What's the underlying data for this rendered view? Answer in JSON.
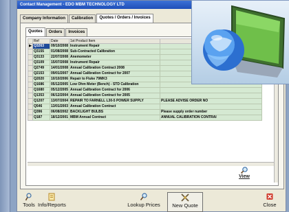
{
  "window": {
    "title": "Contact Management - EDO MBM TECHNOLOGY LTD"
  },
  "outer_tabs": [
    {
      "label": "Company Information"
    },
    {
      "label": "Calibration"
    },
    {
      "label": "Quotes / Orders / Invoices"
    }
  ],
  "inner_tabs": [
    {
      "label": "Quotes"
    },
    {
      "label": "Orders"
    },
    {
      "label": "Invoices"
    }
  ],
  "table": {
    "columns": [
      "Ref",
      "Date",
      "1st Product Item",
      ""
    ],
    "rows": [
      {
        "ref": "Q3263",
        "date": "09/10/2008",
        "item": "Instrument Repair",
        "note": ""
      },
      {
        "ref": "Q3155",
        "date": "01/08/2008",
        "item": "Sub-Contracted Calibration",
        "note": ""
      },
      {
        "ref": "Q3133",
        "date": "22/07/2008",
        "item": "Anemometer",
        "note": ""
      },
      {
        "ref": "Q3109",
        "date": "15/07/2008",
        "item": "Instrument Repair",
        "note": ""
      },
      {
        "ref": "Q2749",
        "date": "14/01/2008",
        "item": "Annual Calibration Contract 2008",
        "note": ""
      },
      {
        "ref": "Q2153",
        "date": "09/01/2007",
        "item": "Annual Calibration Contract for 2007",
        "note": ""
      },
      {
        "ref": "Q2020",
        "date": "10/10/2006",
        "item": "Repair to Fluke 79MK3",
        "note": ""
      },
      {
        "ref": "Q1686",
        "date": "05/12/2005",
        "item": "Low Ohm Meter (Bench) - STD Calibration",
        "note": ""
      },
      {
        "ref": "Q1680",
        "date": "05/12/2005",
        "item": "Annual Calibration Contract for 2006",
        "note": ""
      },
      {
        "ref": "Q1353",
        "date": "06/12/2004",
        "item": "Annual Calibration Contract for 2005",
        "note": ""
      },
      {
        "ref": "Q1207",
        "date": "13/07/2004",
        "item": "REPAIR TO FARNELL L30-5 POWER SUPPLY",
        "note": "PLEASE ADVISE ORDER NO"
      },
      {
        "ref": "Q546",
        "date": "13/01/2003",
        "item": "Annual Calibration Contract",
        "note": ""
      },
      {
        "ref": "Q396",
        "date": "06/08/2002",
        "item": "BACKLIGHT BULBS",
        "note": "Please supply order number"
      },
      {
        "ref": "Q187",
        "date": "18/12/2001",
        "item": "MBM Annual Contract",
        "note": "ANNUAL CALIBRATION CONTRAI"
      }
    ]
  },
  "buttons": {
    "view": "View",
    "tools": "Tools",
    "info_reports": "Info/Reports",
    "lookup_prices": "Lookup Prices",
    "new_quote": "New Quote",
    "close": "Close"
  },
  "icons": {
    "view": "magnifier-icon",
    "tools": "tools-icon",
    "info_reports": "report-icon",
    "lookup_prices": "magnifier-icon",
    "new_quote": "new-quote-icon",
    "close": "close-icon",
    "desktop": "globe-monitor-icon"
  },
  "colors": {
    "row_bg": "#d5e9d2",
    "title_bar": "#2a5cc4",
    "close_icon": "#d03a2c"
  }
}
